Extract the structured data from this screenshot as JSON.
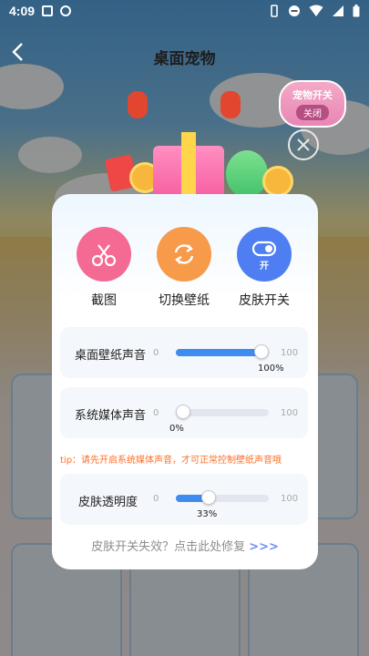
{
  "status_bar": {
    "time": "4:09"
  },
  "header": {
    "back_icon": "chevron-left-icon",
    "title": "桌面宠物"
  },
  "pet_badge": {
    "label": "宠物开关",
    "state": "关闭"
  },
  "actions": [
    {
      "label": "截图",
      "icon": "scissors-icon",
      "color": "#f46a93"
    },
    {
      "label": "切换壁纸",
      "icon": "refresh-icon",
      "color": "#f79a4a"
    },
    {
      "label": "皮肤开关",
      "icon": "toggle-icon",
      "badge": "开",
      "color": "#4f7ef2"
    }
  ],
  "sliders": [
    {
      "label": "桌面壁纸声音",
      "min": "0",
      "max": "100",
      "value": 100,
      "value_text": "100%"
    },
    {
      "label": "系统媒体声音",
      "min": "0",
      "max": "100",
      "value": 0,
      "value_text": "0%"
    },
    {
      "label": "皮肤透明度",
      "min": "0",
      "max": "100",
      "value": 33,
      "value_text": "33%"
    }
  ],
  "tip": "tip：请先开启系统媒体声音，才可正常控制壁纸声音哦",
  "repair": {
    "text": "皮肤开关失效？点击此处修复",
    "arrows": ">>>"
  }
}
